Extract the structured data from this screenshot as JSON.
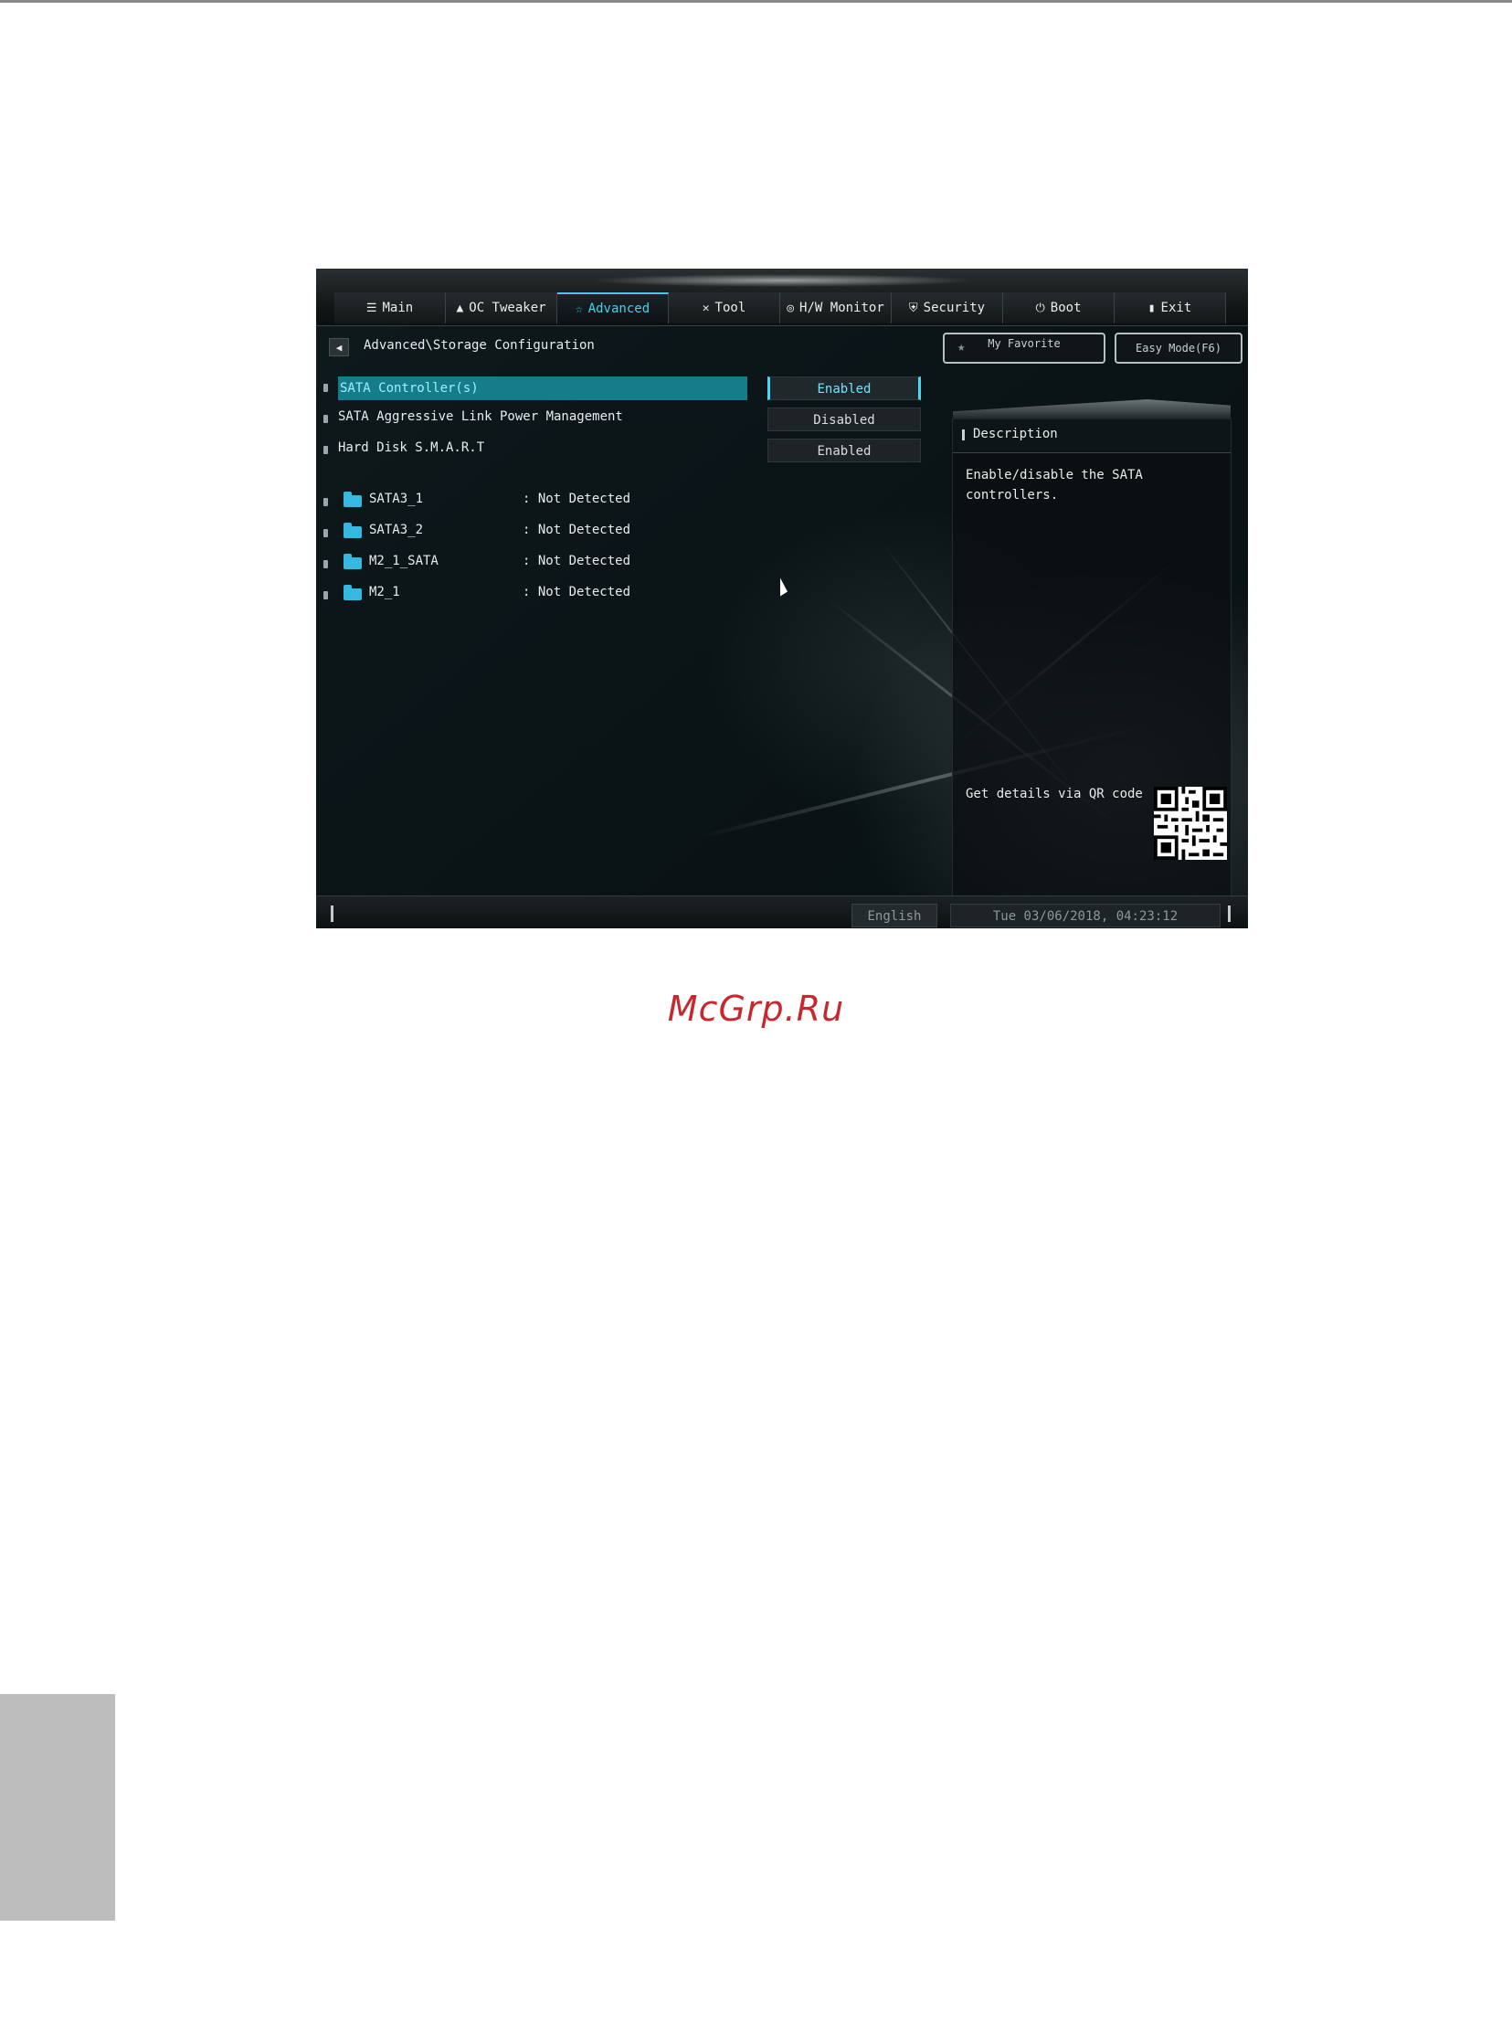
{
  "tabs": [
    {
      "label": "Main",
      "icon": "list-icon",
      "active": false
    },
    {
      "label": "OC Tweaker",
      "icon": "rocket-icon",
      "active": false
    },
    {
      "label": "Advanced",
      "icon": "star-icon",
      "active": true
    },
    {
      "label": "Tool",
      "icon": "tools-icon",
      "active": false
    },
    {
      "label": "H/W Monitor",
      "icon": "monitor-icon",
      "active": false
    },
    {
      "label": "Security",
      "icon": "shield-icon",
      "active": false
    },
    {
      "label": "Boot",
      "icon": "power-icon",
      "active": false
    },
    {
      "label": "Exit",
      "icon": "door-icon",
      "active": false
    }
  ],
  "breadcrumb": "Advanced\\Storage Configuration",
  "buttons": {
    "my_favorite": "My Favorite",
    "easy_mode": "Easy Mode(F6)"
  },
  "settings": [
    {
      "label": "SATA Controller(s)",
      "value": "Enabled",
      "selected": true
    },
    {
      "label": "SATA Aggressive Link Power Management",
      "value": "Disabled",
      "selected": false
    },
    {
      "label": "Hard Disk S.M.A.R.T",
      "value": "Enabled",
      "selected": false
    }
  ],
  "devices": [
    {
      "name": "SATA3_1",
      "status": ": Not Detected"
    },
    {
      "name": "SATA3_2",
      "status": ": Not Detected"
    },
    {
      "name": "M2_1_SATA",
      "status": ": Not Detected"
    },
    {
      "name": "M2_1",
      "status": ": Not Detected"
    }
  ],
  "description": {
    "title": "Description",
    "text": "Enable/disable the SATA\ncontrollers.",
    "qr_label": "Get details via QR code"
  },
  "footer": {
    "language": "English",
    "datetime": "Tue 03/06/2018, 04:23:12"
  },
  "watermark": "McGrp.Ru",
  "colors": {
    "accent": "#3fd4f0",
    "selection": "#157c8a",
    "watermark": "#c8272d"
  }
}
